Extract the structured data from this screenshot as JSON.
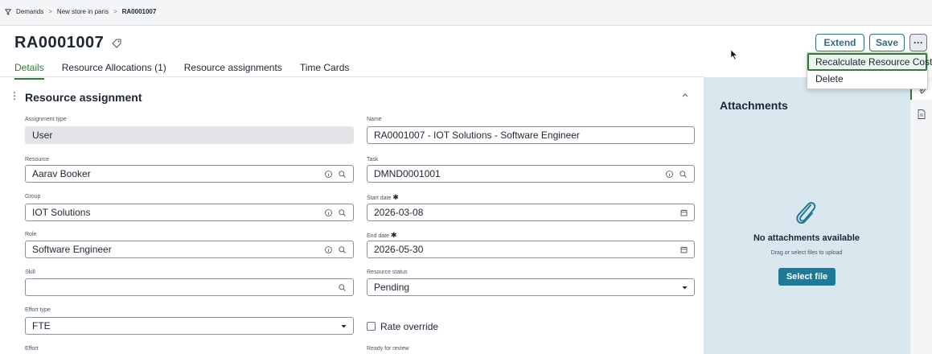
{
  "breadcrumb": {
    "items": [
      "Demands",
      "New store in paris",
      "RA0001007"
    ],
    "separator": ">"
  },
  "header": {
    "title": "RA0001007"
  },
  "tabs": [
    {
      "label": "Details",
      "active": true
    },
    {
      "label": "Resource Allocations (1)",
      "active": false
    },
    {
      "label": "Resource assignments",
      "active": false
    },
    {
      "label": "Time Cards",
      "active": false
    }
  ],
  "toolbar": {
    "extend_label": "Extend",
    "save_label": "Save",
    "more_label": "···"
  },
  "menu": {
    "items": [
      "Recalculate Resource Cost",
      "Delete"
    ],
    "highlighted": "Recalculate Resource Cost"
  },
  "section": {
    "title": "Resource assignment"
  },
  "form": {
    "assignment_type": {
      "label": "Assignment type",
      "value": "User"
    },
    "name": {
      "label": "Name",
      "value": "RA0001007 - IOT Solutions - Software Engineer"
    },
    "resource": {
      "label": "Resource",
      "value": "Aarav Booker"
    },
    "task": {
      "label": "Task",
      "value": "DMND0001001"
    },
    "group": {
      "label": "Group",
      "value": "IOT Solutions"
    },
    "start_date": {
      "label": "Start date",
      "value": "2026-03-08"
    },
    "role": {
      "label": "Role",
      "value": "Software Engineer"
    },
    "end_date": {
      "label": "End date",
      "value": "2026-05-30"
    },
    "skill": {
      "label": "Skill",
      "value": ""
    },
    "resource_status": {
      "label": "Resource status",
      "value": "Pending"
    },
    "effort_type": {
      "label": "Effort type",
      "value": "FTE"
    },
    "rate_override": {
      "label": "Rate override",
      "checked": false
    },
    "effort": {
      "label": "Effort"
    },
    "ready_for_review": {
      "label": "Ready for review"
    },
    "required_mark": "✱"
  },
  "attachments": {
    "title": "Attachments",
    "empty_text": "No attachments available",
    "hint": "Drag or select files to upload",
    "button_label": "Select file"
  },
  "colors": {
    "accent": "#2e7d32",
    "primary": "#1f7a99",
    "side_panel": "#d9e7ee"
  }
}
